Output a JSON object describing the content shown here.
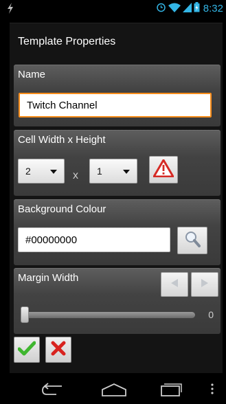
{
  "status_bar": {
    "time": "8:32"
  },
  "dialog": {
    "title": "Template Properties",
    "name": {
      "label": "Name",
      "value": "Twitch Channel"
    },
    "cell_size": {
      "label": "Cell Width x Height",
      "width_value": "2",
      "separator": "x",
      "height_value": "1"
    },
    "background": {
      "label": "Background Colour",
      "value": "#00000000"
    },
    "margin": {
      "label": "Margin Width",
      "value": "0",
      "level": 0
    }
  },
  "icons": {
    "flash": "flash-icon",
    "alarm": "alarm-icon",
    "wifi": "wifi-icon",
    "signal": "signal-icon",
    "battery": "battery-icon",
    "warning": "warning-icon",
    "search": "magnifier-icon",
    "ok": "checkmark-icon",
    "cancel": "red-x-icon"
  },
  "colors": {
    "accent": "#33b5e5",
    "focus_border": "#ff8d1a",
    "ok_green": "#3fb62f",
    "cancel_red": "#d8231f"
  }
}
